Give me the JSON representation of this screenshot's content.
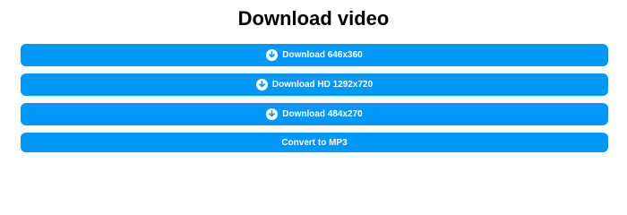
{
  "page": {
    "title": "Download video"
  },
  "buttons": [
    {
      "label": "Download 646x360",
      "icon": "download-circle-icon"
    },
    {
      "label": "Download HD 1292x720",
      "icon": "download-circle-icon"
    },
    {
      "label": "Download 484x270",
      "icon": "download-circle-icon"
    },
    {
      "label": "Convert to MP3"
    }
  ],
  "colors": {
    "button_bg": "#0097f6",
    "button_text": "#ffffff",
    "title_text": "#000000",
    "page_bg": "#ffffff"
  }
}
